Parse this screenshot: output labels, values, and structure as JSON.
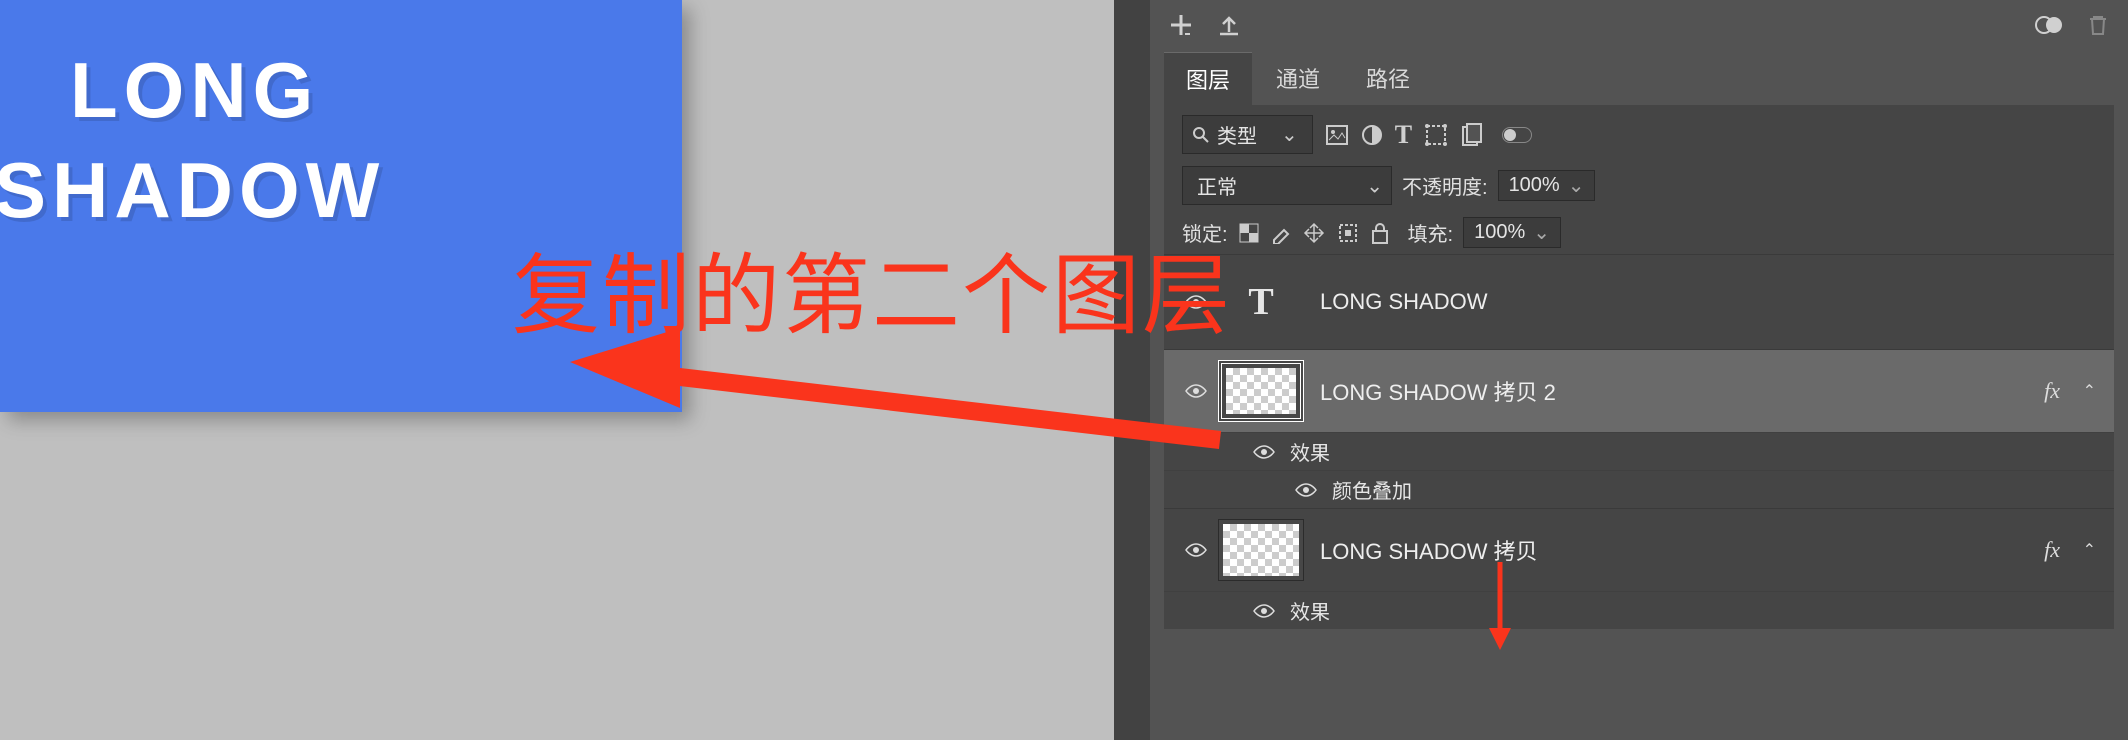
{
  "canvas": {
    "line1": "LONG",
    "line2": "SHADOW"
  },
  "annotation": {
    "text": "复制的第二个图层"
  },
  "panel": {
    "tabs": {
      "layers": "图层",
      "channels": "通道",
      "paths": "路径"
    },
    "filter": {
      "label": "类型"
    },
    "blend": {
      "mode": "正常",
      "opacity_label": "不透明度:",
      "opacity_value": "100%"
    },
    "lock": {
      "label": "锁定:",
      "fill_label": "填充:",
      "fill_value": "100%"
    },
    "layers_list": [
      {
        "name": "LONG SHADOW",
        "type": "text"
      },
      {
        "name": "LONG SHADOW 拷贝 2",
        "type": "raster",
        "selected": true,
        "fx": "fx"
      },
      {
        "name": "LONG SHADOW 拷贝",
        "type": "raster",
        "fx": "fx"
      }
    ],
    "effects": {
      "label": "效果",
      "color_overlay": "颜色叠加"
    }
  }
}
